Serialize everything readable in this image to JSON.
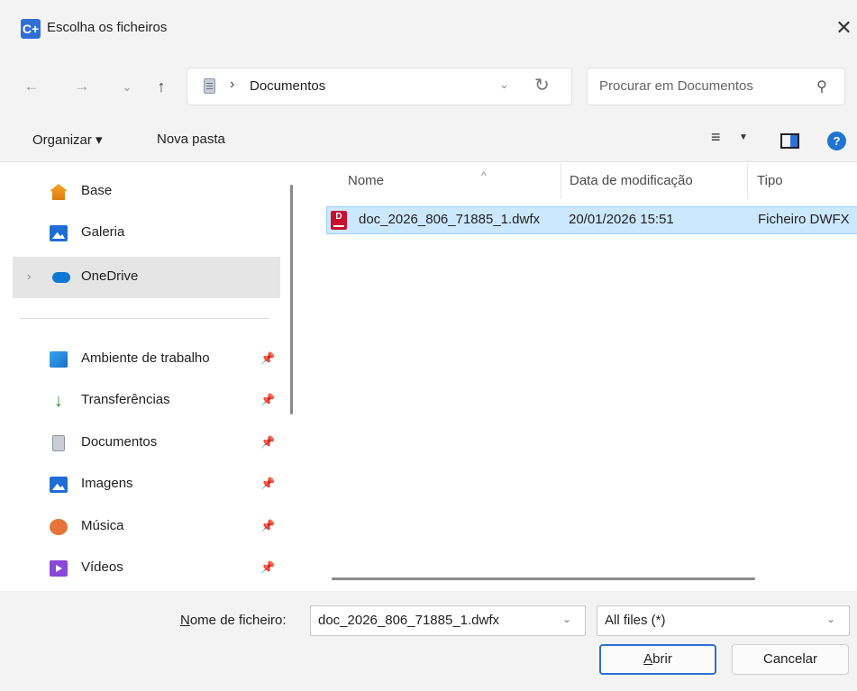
{
  "window": {
    "title": "Escolha os ficheiros",
    "app_icon_glyph": "C+"
  },
  "nav": {
    "back_icon": "←",
    "forward_icon": "→",
    "recent_icon": "⌄",
    "up_icon": "↑",
    "address_separator": "›",
    "address_location": "Documentos",
    "search_placeholder": "Procurar em Documentos"
  },
  "toolbar": {
    "organize_label": "Organizar ▾",
    "new_folder_label": "Nova pasta",
    "help_glyph": "?"
  },
  "sidebar": {
    "items": [
      {
        "label": "Base",
        "icon": "home-icon"
      },
      {
        "label": "Galeria",
        "icon": "gallery-icon"
      },
      {
        "label": "OneDrive",
        "icon": "onedrive-icon",
        "selected": true
      },
      {
        "label": "Ambiente de trabalho",
        "icon": "desktop-icon",
        "pinned": true
      },
      {
        "label": "Transferências",
        "icon": "download-icon",
        "pinned": true
      },
      {
        "label": "Documentos",
        "icon": "documents-icon",
        "pinned": true
      },
      {
        "label": "Imagens",
        "icon": "images-icon",
        "pinned": true
      },
      {
        "label": "Música",
        "icon": "music-icon",
        "pinned": true
      },
      {
        "label": "Vídeos",
        "icon": "videos-icon",
        "pinned": true
      }
    ]
  },
  "file_list": {
    "columns": [
      "Nome",
      "Data de modificação",
      "Tipo"
    ],
    "rows": [
      {
        "name": "doc_2026_806_71885_1.dwfx",
        "modified": "20/01/2026 15:51",
        "type": "Ficheiro DWFX",
        "selected": true
      }
    ]
  },
  "footer": {
    "filename_label_underlined": "N",
    "filename_label_rest": "ome de ficheiro:",
    "filename_value": "doc_2026_806_71885_1.dwfx",
    "filter_value": "All files (*)",
    "open_underlined": "A",
    "open_rest": "brir",
    "cancel_label": "Cancelar"
  },
  "colors": {
    "selection_bg": "#cce8ff",
    "selection_border": "#99d1ff",
    "accent": "#2d6ecf",
    "chrome_bg": "#f3f3f3"
  }
}
